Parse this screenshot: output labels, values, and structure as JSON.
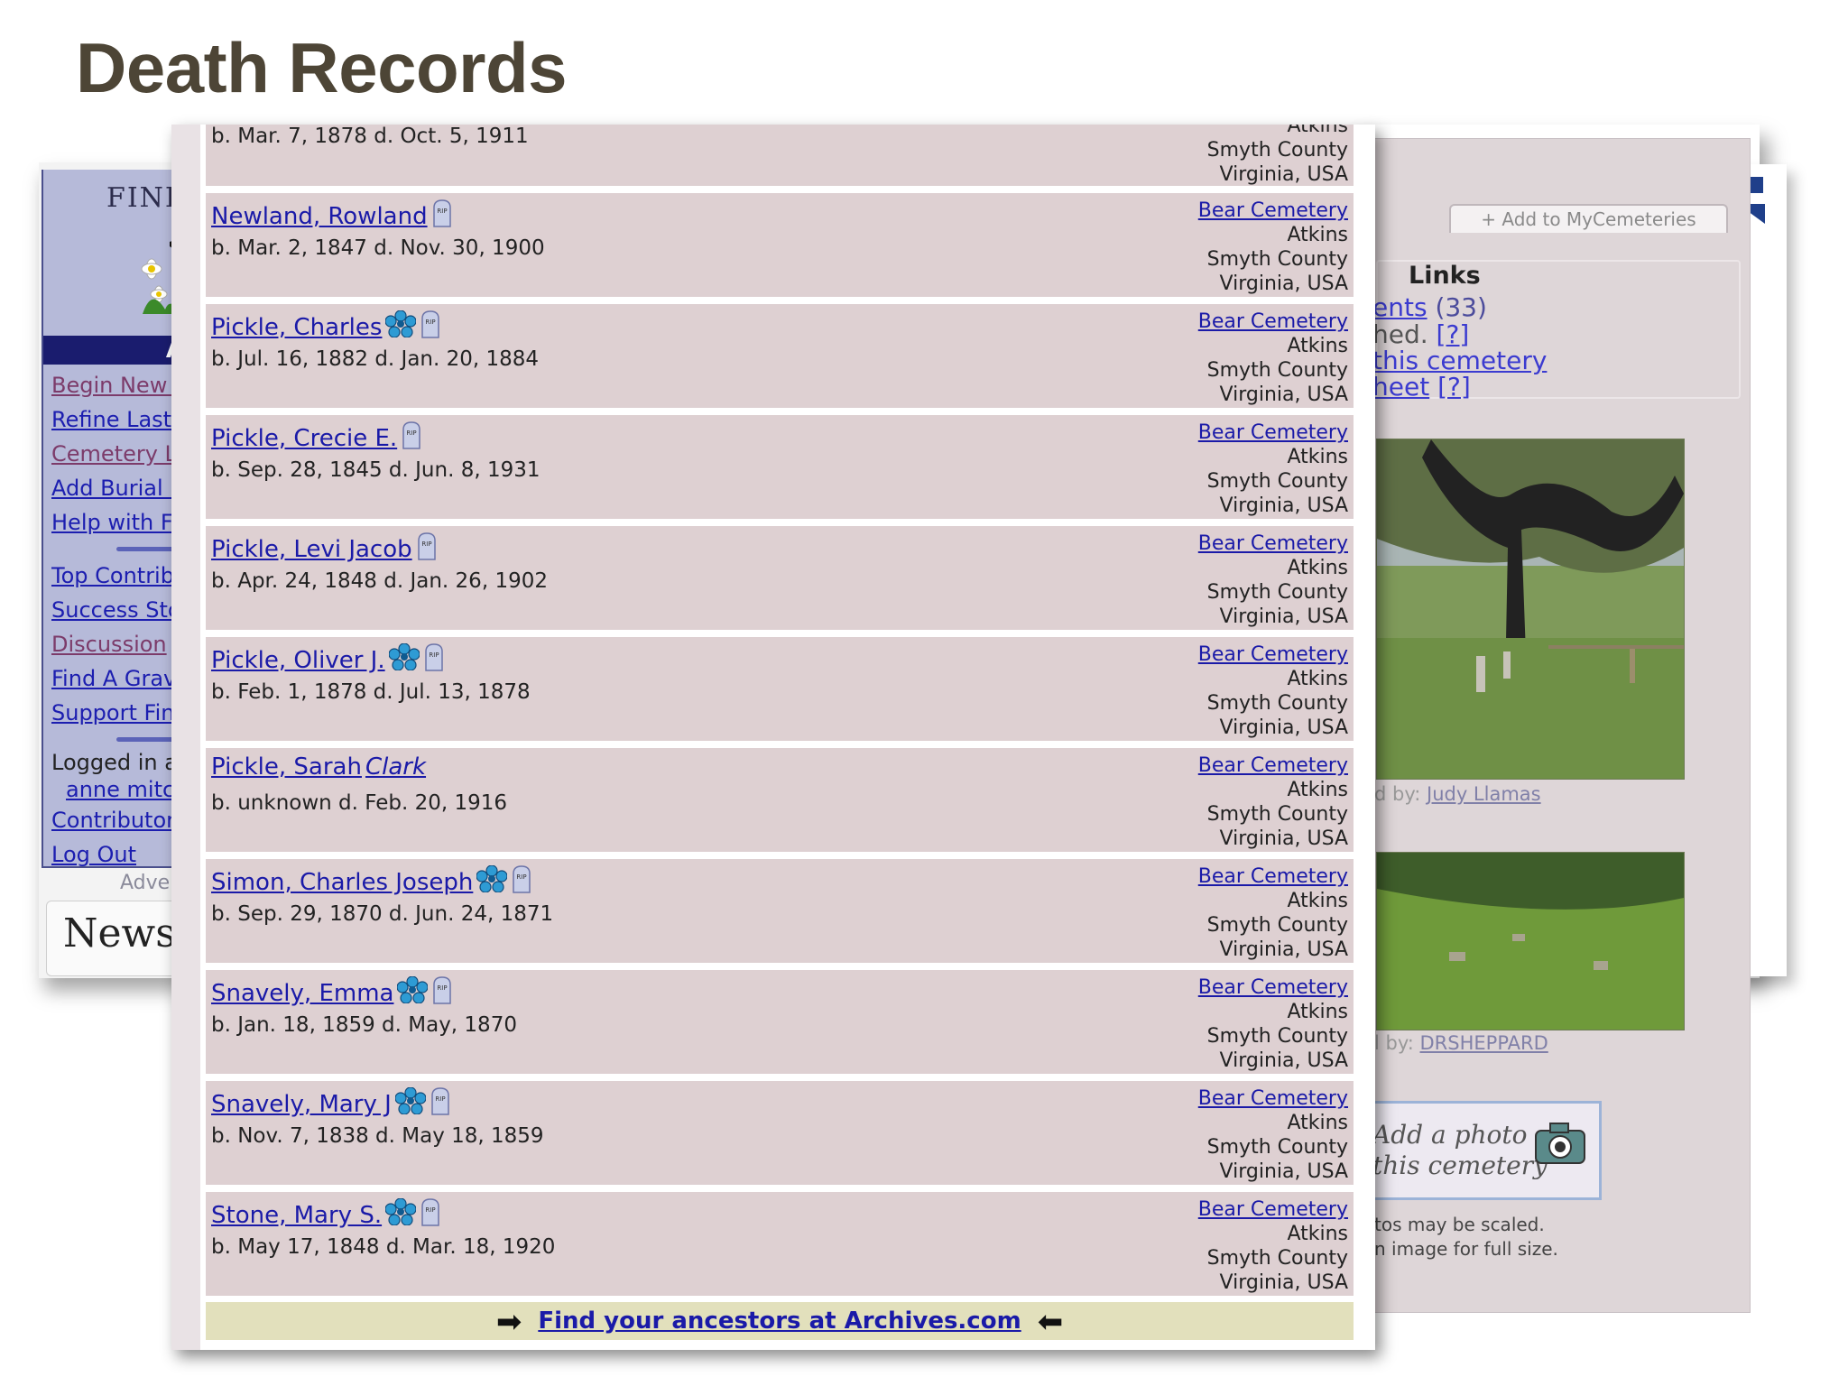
{
  "slide": {
    "title": "Death Records"
  },
  "left_site": {
    "logo_text": "FIND",
    "nav_header": "A",
    "links": [
      {
        "label": "Begin New S",
        "visited": true
      },
      {
        "label": "Refine Last",
        "visited": false
      },
      {
        "label": "Cemetery L",
        "visited": true
      },
      {
        "label": "Add Burial I",
        "visited": false
      },
      {
        "label": "Help with Fi",
        "visited": false
      }
    ],
    "links2": [
      {
        "label": "Top Contrib",
        "visited": false
      },
      {
        "label": "Success Sto",
        "visited": false
      },
      {
        "label": "Discussion",
        "visited": true
      },
      {
        "label": "Find A Grav",
        "visited": false
      },
      {
        "label": "Support Fin",
        "visited": false
      }
    ],
    "logged_in_label": "Logged in a",
    "user": "anne mitc",
    "contributor": "Contributor",
    "logout": "Log Out",
    "advert_label": "Adve",
    "news_text": "News"
  },
  "right_site": {
    "add_mycemeteries": "+ Add to MyCemeteries",
    "links_title": "Links",
    "links_lines": [
      {
        "link": "ents",
        "rest": " (33)"
      },
      {
        "link": "",
        "rest": "hed. ",
        "bracket": "[?]"
      },
      {
        "link": "this cemetery",
        "rest": ""
      },
      {
        "link": "heet",
        "rest": " ",
        "bracket": "[?]"
      }
    ],
    "photo1_credit_prefix": "d by: ",
    "photo1_credit": "Judy Llamas",
    "photo2_credit_prefix": "l by: ",
    "photo2_credit": "DRSHEPPARD",
    "add_photo_line1": "Add a photo",
    "add_photo_line2": "this cemetery",
    "scale_note_1": "tos may be scaled.",
    "scale_note_2": "n image for full size."
  },
  "records": [
    {
      "name": "",
      "name_italic": "",
      "dates": "b. Mar. 7, 1878 d. Oct. 5, 1911",
      "flower": false,
      "rip": false,
      "cemetery": "",
      "town": "Atkins",
      "county": "Smyth County",
      "state": "Virginia, USA"
    },
    {
      "name": "Newland, Rowland",
      "name_italic": "",
      "dates": "b. Mar. 2, 1847 d. Nov. 30, 1900",
      "flower": false,
      "rip": true,
      "cemetery": "Bear Cemetery",
      "town": "Atkins",
      "county": "Smyth County",
      "state": "Virginia, USA"
    },
    {
      "name": "Pickle, Charles",
      "name_italic": "",
      "dates": "b. Jul. 16, 1882 d. Jan. 20, 1884",
      "flower": true,
      "rip": true,
      "cemetery": "Bear Cemetery",
      "town": "Atkins",
      "county": "Smyth County",
      "state": "Virginia, USA"
    },
    {
      "name": "Pickle, Crecie E.",
      "name_italic": "",
      "dates": "b. Sep. 28, 1845 d. Jun. 8, 1931",
      "flower": false,
      "rip": true,
      "cemetery": "Bear Cemetery",
      "town": "Atkins",
      "county": "Smyth County",
      "state": "Virginia, USA"
    },
    {
      "name": "Pickle, Levi Jacob",
      "name_italic": "",
      "dates": "b. Apr. 24, 1848 d. Jan. 26, 1902",
      "flower": false,
      "rip": true,
      "cemetery": "Bear Cemetery",
      "town": "Atkins",
      "county": "Smyth County",
      "state": "Virginia, USA"
    },
    {
      "name": "Pickle, Oliver J.",
      "name_italic": "",
      "dates": "b. Feb. 1, 1878 d. Jul. 13, 1878",
      "flower": true,
      "rip": true,
      "cemetery": "Bear Cemetery",
      "town": "Atkins",
      "county": "Smyth County",
      "state": "Virginia, USA"
    },
    {
      "name": "Pickle, Sarah ",
      "name_italic": "Clark",
      "dates": "b. unknown d. Feb. 20, 1916",
      "flower": false,
      "rip": false,
      "cemetery": "Bear Cemetery",
      "town": "Atkins",
      "county": "Smyth County",
      "state": "Virginia, USA"
    },
    {
      "name": "Simon, Charles Joseph",
      "name_italic": "",
      "dates": "b. Sep. 29, 1870 d. Jun. 24, 1871",
      "flower": true,
      "rip": true,
      "cemetery": "Bear Cemetery",
      "town": "Atkins",
      "county": "Smyth County",
      "state": "Virginia, USA"
    },
    {
      "name": "Snavely, Emma",
      "name_italic": "",
      "dates": "b. Jan. 18, 1859 d. May, 1870",
      "flower": true,
      "rip": true,
      "cemetery": "Bear Cemetery",
      "town": "Atkins",
      "county": "Smyth County",
      "state": "Virginia, USA"
    },
    {
      "name": "Snavely, Mary J",
      "name_italic": "",
      "dates": "b. Nov. 7, 1838 d. May 18, 1859",
      "flower": true,
      "rip": true,
      "cemetery": "Bear Cemetery",
      "town": "Atkins",
      "county": "Smyth County",
      "state": "Virginia, USA"
    },
    {
      "name": "Stone, Mary S.",
      "name_italic": "",
      "dates": "b. May 17, 1848 d. Mar. 18, 1920",
      "flower": true,
      "rip": true,
      "cemetery": "Bear Cemetery",
      "town": "Atkins",
      "county": "Smyth County",
      "state": "Virginia, USA"
    }
  ],
  "archives": {
    "link_text": "Find your ancestors at Archives.com"
  },
  "colors": {
    "row_bg": "#ded0d2",
    "link": "#1a1aa8",
    "nav_bg": "#b6bad9",
    "archives_bg": "#e2e0bc"
  }
}
